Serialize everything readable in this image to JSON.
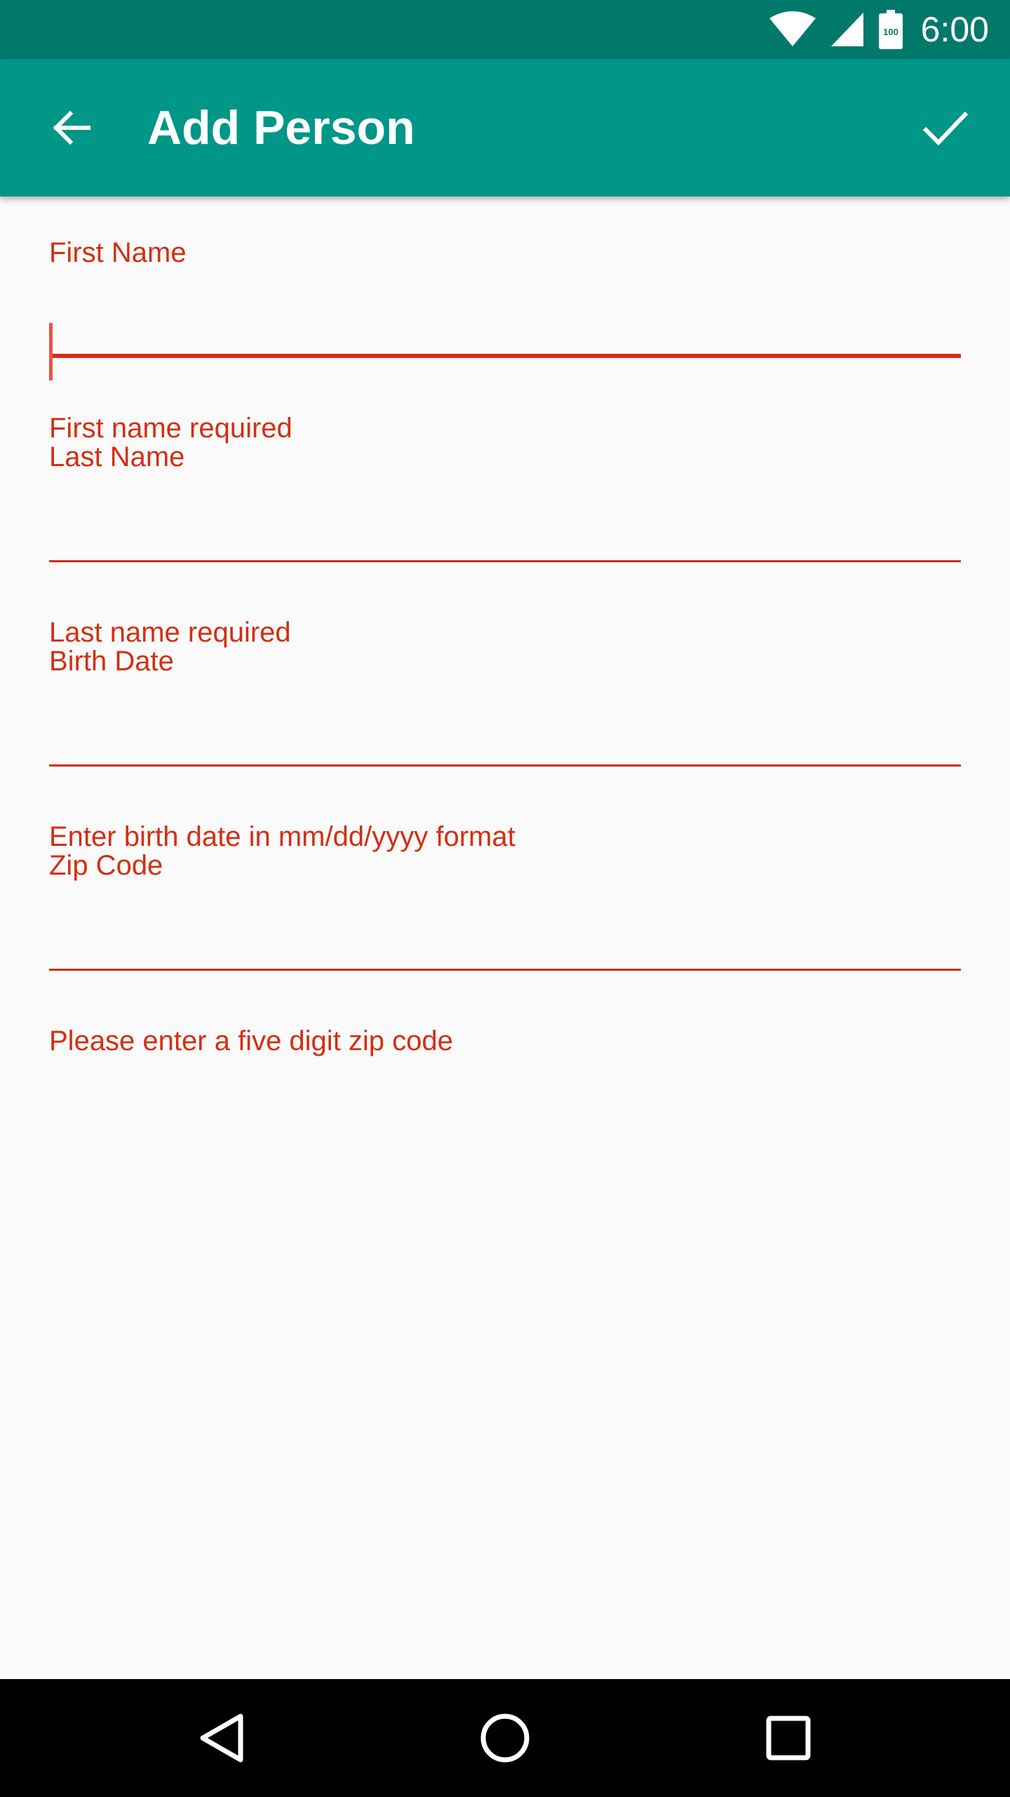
{
  "status_bar": {
    "time": "6:00",
    "battery_level": "100",
    "icons": [
      "wifi-icon",
      "cell-signal-icon",
      "battery-icon"
    ]
  },
  "app_bar": {
    "title": "Add Person",
    "back_icon": "arrow-back-icon",
    "action_icon": "check-icon"
  },
  "form": {
    "fields": [
      {
        "label": "First Name",
        "value": "",
        "error": "First name required",
        "focused": true
      },
      {
        "label": "Last Name",
        "value": "",
        "error": "Last name required",
        "focused": false
      },
      {
        "label": "Birth Date",
        "value": "",
        "error": "Enter birth date in mm/dd/yyyy format",
        "focused": false
      },
      {
        "label": "Zip Code",
        "value": "",
        "error": "Please enter a five digit zip code",
        "focused": false
      }
    ]
  },
  "nav_bar": {
    "icons": [
      "nav-back-icon",
      "nav-home-icon",
      "nav-recents-icon"
    ]
  },
  "colors": {
    "status_bar": "#00796B",
    "app_bar": "#009688",
    "error": "#D32F12",
    "background": "#FAFAFA",
    "nav_bar": "#000000"
  }
}
